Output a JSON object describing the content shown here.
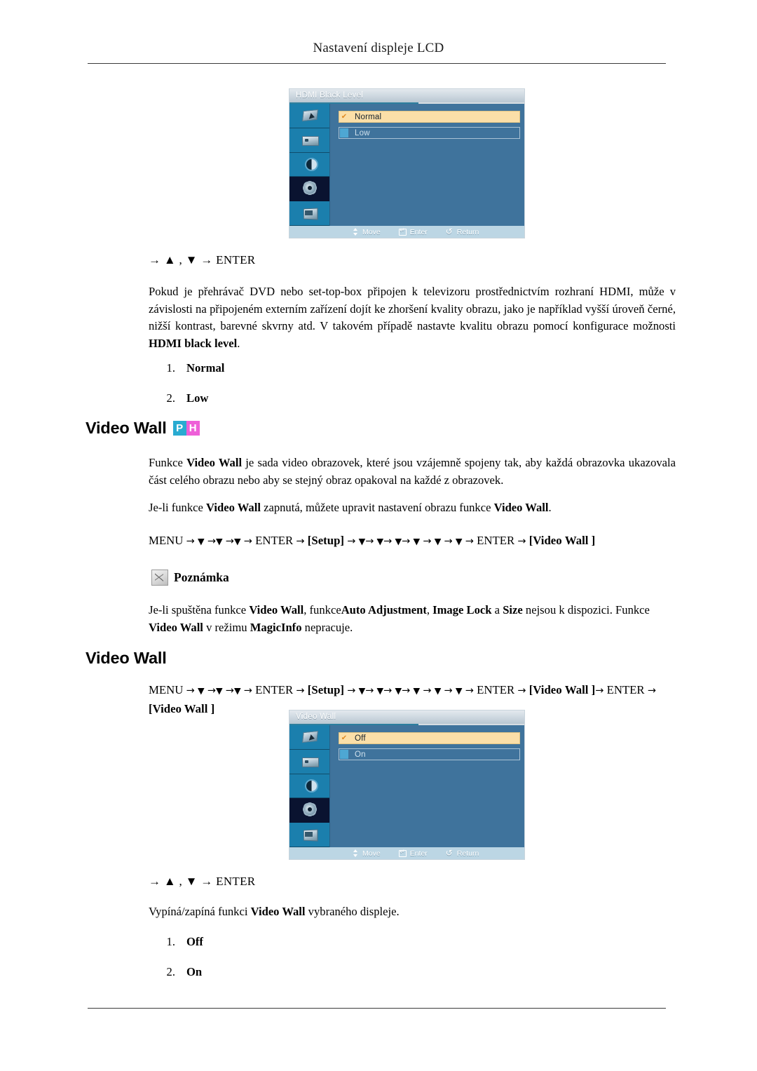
{
  "page": {
    "header_title": "Nastavení displeje LCD"
  },
  "osd_hdmi": {
    "title": "HDMI Black Level",
    "rail_icons": [
      "picture-icon",
      "display-icon",
      "contrast-icon",
      "gear-icon",
      "screen-icon"
    ],
    "active_rail_index": 3,
    "options": [
      {
        "label": "Normal",
        "selected": true,
        "check": "✔"
      },
      {
        "label": "Low",
        "selected": false,
        "check": ""
      }
    ],
    "footer": [
      {
        "icon": "move-icon",
        "label": "Move"
      },
      {
        "icon": "enter-icon",
        "label": "Enter"
      },
      {
        "icon": "return-icon",
        "label": "Return"
      }
    ]
  },
  "osd_videowall": {
    "title": "Video Wall",
    "rail_icons": [
      "picture-icon",
      "display-icon",
      "contrast-icon",
      "gear-icon",
      "screen-icon"
    ],
    "active_rail_index": 3,
    "options": [
      {
        "label": "Off",
        "selected": true,
        "check": "✔"
      },
      {
        "label": "On",
        "selected": false,
        "check": ""
      }
    ],
    "footer": [
      {
        "icon": "move-icon",
        "label": "Move"
      },
      {
        "icon": "enter-icon",
        "label": "Enter"
      },
      {
        "icon": "return-icon",
        "label": "Return"
      }
    ]
  },
  "key_hint_1": "→ ▲ , ▼ → ENTER",
  "key_hint_2": "→ ▲ , ▼ → ENTER",
  "paragraph_hdmi": {
    "text_1": "Pokud je přehrávač DVD nebo set-top-box připojen k televizoru prostřednictvím rozhraní HDMI, může v závislosti na připojeném externím zařízení dojít ke zhoršení kvality obrazu, jako je například vyšší úroveň černé, nižší kontrast, barevné skvrny atd. V takovém případě nastavte kvalitu obrazu pomocí konfigurace možnosti ",
    "bold_1": "HDMI black level",
    "text_2": "."
  },
  "list_hdmi": [
    {
      "num": "1.",
      "label": "Normal"
    },
    {
      "num": "2.",
      "label": "Low"
    }
  ],
  "heading_videowall_1": {
    "text": "Video Wall",
    "badge_p": "P",
    "badge_h": "H",
    "badge_p_color": "#29abd1",
    "badge_h_color": "#ee5fd8"
  },
  "paragraph_videowall": {
    "p1_a": "Funkce ",
    "p1_b": "Video Wall",
    "p1_c": " je sada video obrazovek, které jsou vzájemně spojeny tak, aby každá obrazovka ukazovala část celého obrazu nebo aby se stejný obraz opakoval na každé z obrazovek.",
    "p2_a": "Je-li funkce ",
    "p2_b": "Video Wall",
    "p2_c": " zapnutá, můžete upravit nastavení obrazu funkce ",
    "p2_d": "Video Wall",
    "p2_e": "."
  },
  "menupath_1": {
    "menu": "MENU",
    "arrow": "→",
    "tri": "▼",
    "enter": "ENTER",
    "setup": "[Setup]",
    "tail_video": "[Video",
    "tail_wall": "Wall ]"
  },
  "note": {
    "icon": "note-pencil-icon",
    "label": "Poznámka",
    "line1_a": "Je-li spuštěna funkce ",
    "line1_b": "Video Wall",
    "line1_c": ", funkce",
    "line1_d": "Auto Adjustment",
    "line1_e": ", ",
    "line1_f": "Image Lock",
    "line1_g": " a ",
    "line1_h": "Size",
    "line1_i": " nejsou k dispozici.",
    "line2_a": "Funkce ",
    "line2_b": "Video Wall",
    "line2_c": " v režimu ",
    "line2_d": "MagicInfo",
    "line2_e": " nepracuje."
  },
  "heading_videowall_2": {
    "text": "Video Wall"
  },
  "menupath_2": {
    "menu": "MENU",
    "arrow": "→",
    "tri": "▼",
    "enter": "ENTER",
    "setup": "[Setup]",
    "tail_video": "[Video",
    "tail_wall": "Wall ]",
    "tail_enter": "ENTER",
    "tail_videowall": "[Video Wall ]"
  },
  "description_videowall": {
    "a": "Vypíná/zapíná funkci ",
    "b": "Video Wall",
    "c": " vybraného displeje."
  },
  "list_videowall": [
    {
      "num": "1.",
      "label": "Off"
    },
    {
      "num": "2.",
      "label": "On"
    }
  ]
}
